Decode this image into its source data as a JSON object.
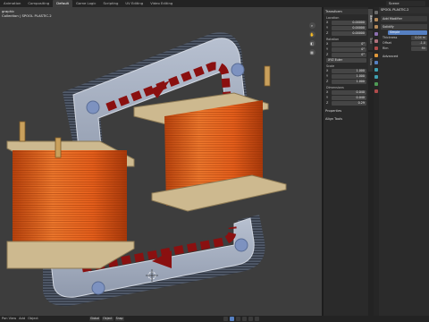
{
  "workspace_tabs": [
    "Animation",
    "Compositing",
    "Default",
    "Game Logic",
    "Scripting",
    "UV Editing",
    "Video Editing"
  ],
  "active_tab": "Default",
  "scene_field": "Scene",
  "viewport": {
    "mode": "graphic",
    "collection": "Collection | SPOOL PLASTIC.2"
  },
  "n_panel": {
    "header": "Transform",
    "location_label": "Location",
    "location": [
      [
        "X",
        "0.00000"
      ],
      [
        "Y",
        "0.00000"
      ],
      [
        "Z",
        "0.00000"
      ]
    ],
    "rotation_label": "Rotation",
    "rotation": [
      [
        "X",
        "0°"
      ],
      [
        "Y",
        "0°"
      ],
      [
        "Z",
        "0°"
      ]
    ],
    "rotation_mode": "XYZ Euler",
    "scale_label": "Scale",
    "scale": [
      [
        "X",
        "1.000"
      ],
      [
        "Y",
        "1.000"
      ],
      [
        "Z",
        "1.000"
      ]
    ],
    "dimensions_label": "Dimensions",
    "dimensions": [
      [
        "X",
        "0.040"
      ],
      [
        "Y",
        "0.040"
      ],
      [
        "Z",
        "0.29"
      ]
    ],
    "properties_label": "Properties",
    "align_tools_label": "Align Tools"
  },
  "side_tabs": [
    "Item",
    "Tool",
    "View"
  ],
  "properties_panel": {
    "object_name": "SPOOL PLASTIC.2",
    "add_modifier": "Add Modifier",
    "modifier_name": "Solidify",
    "mode_value": "Simple",
    "rows": [
      [
        "Thickness",
        "0.04 m"
      ],
      [
        "Offset",
        "-1.0"
      ],
      [
        "Rim",
        "Fill"
      ]
    ],
    "advanced": "Advanced"
  },
  "statusbar": {
    "left": [
      "Pan View",
      "Add",
      "Object"
    ],
    "tools": [
      "Global",
      "Object",
      "Snap"
    ]
  },
  "colors": {
    "viewport_bg": "#3d3d3d",
    "coil_copper": "#e8601c",
    "bobbin": "#c9b48a",
    "core_plate": "#9aa4b6",
    "flux_arrow": "#8a1010",
    "accent": "#5680c2"
  }
}
